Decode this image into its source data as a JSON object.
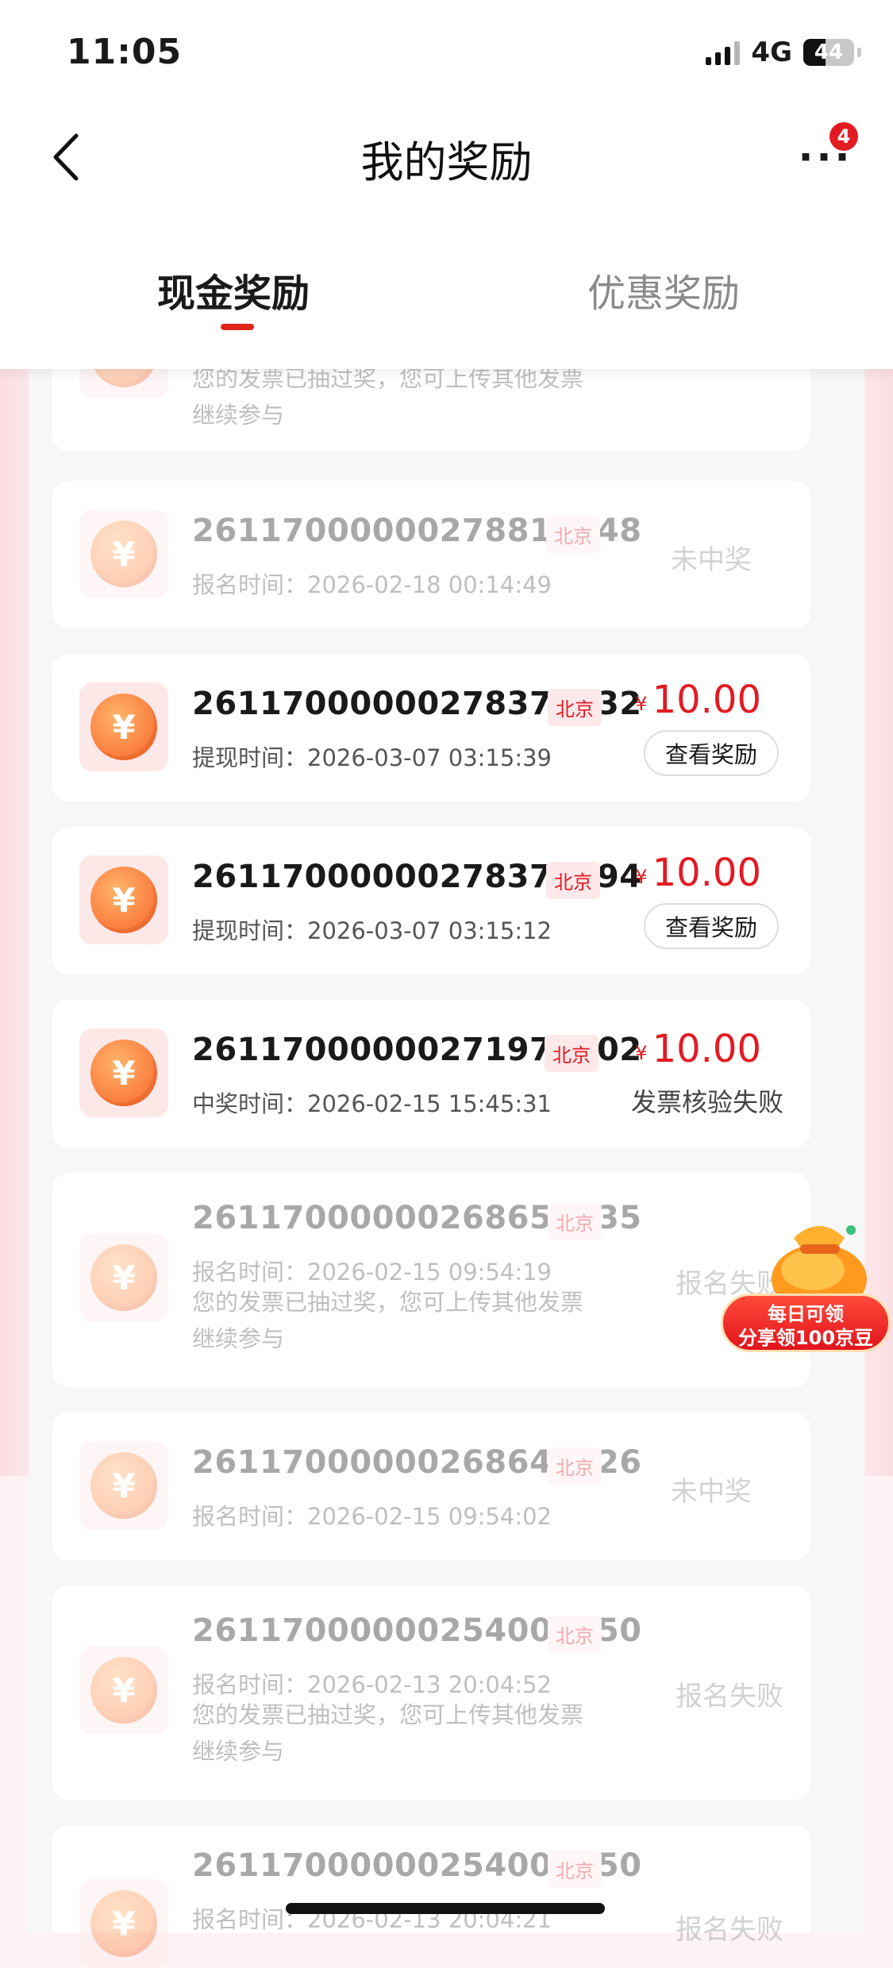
{
  "status_bar": {
    "time": "11:05",
    "network": "4G",
    "battery": "44"
  },
  "nav": {
    "title": "我的奖励",
    "badge_count": "4"
  },
  "tabs": [
    {
      "label": "现金奖励"
    },
    {
      "label": "优惠奖励"
    }
  ],
  "cards": [
    {
      "note_line1": "您的发票已抽过奖，您可上传其他发票",
      "note_line2": "继续参与"
    },
    {
      "id": "26117000000278815348",
      "city": "北京",
      "time": "报名时间：2026-02-18 00:14:49",
      "status": "未中奖"
    },
    {
      "id": "26117000000278378332",
      "city": "北京",
      "time": "提现时间：2026-03-07 03:15:39",
      "currency": "¥",
      "amount": "10.00",
      "button": "查看奖励"
    },
    {
      "id": "26117000000278377694",
      "city": "北京",
      "time": "提现时间：2026-03-07 03:15:12",
      "currency": "¥",
      "amount": "10.00",
      "button": "查看奖励"
    },
    {
      "id": "26117000000271975202",
      "city": "北京",
      "time": "中奖时间：2026-02-15 15:45:31",
      "currency": "¥",
      "amount": "10.00",
      "status": "发票核验失败"
    },
    {
      "id": "26117000000268657835",
      "city": "北京",
      "time": "报名时间：2026-02-15 09:54:19",
      "note_line1": "您的发票已抽过奖，您可上传其他发票",
      "note_line2": "继续参与",
      "status": "报名失败"
    },
    {
      "id": "26117000000268645926",
      "city": "北京",
      "time": "报名时间：2026-02-15 09:54:02",
      "status": "未中奖"
    },
    {
      "id": "26117000000254002050",
      "city": "北京",
      "time": "报名时间：2026-02-13 20:04:52",
      "note_line1": "您的发票已抽过奖，您可上传其他发票",
      "note_line2": "继续参与",
      "status": "报名失败"
    },
    {
      "id": "26117000000254002050",
      "city": "北京",
      "time": "报名时间：2026-02-13 20:04:21",
      "status": "报名失败"
    }
  ],
  "coin_symbol": "¥",
  "promo": {
    "line1": "每日可领",
    "line2": "分享领100京豆"
  },
  "colors": {
    "accent": "#e21b23",
    "coin": "#fb7b3c"
  }
}
